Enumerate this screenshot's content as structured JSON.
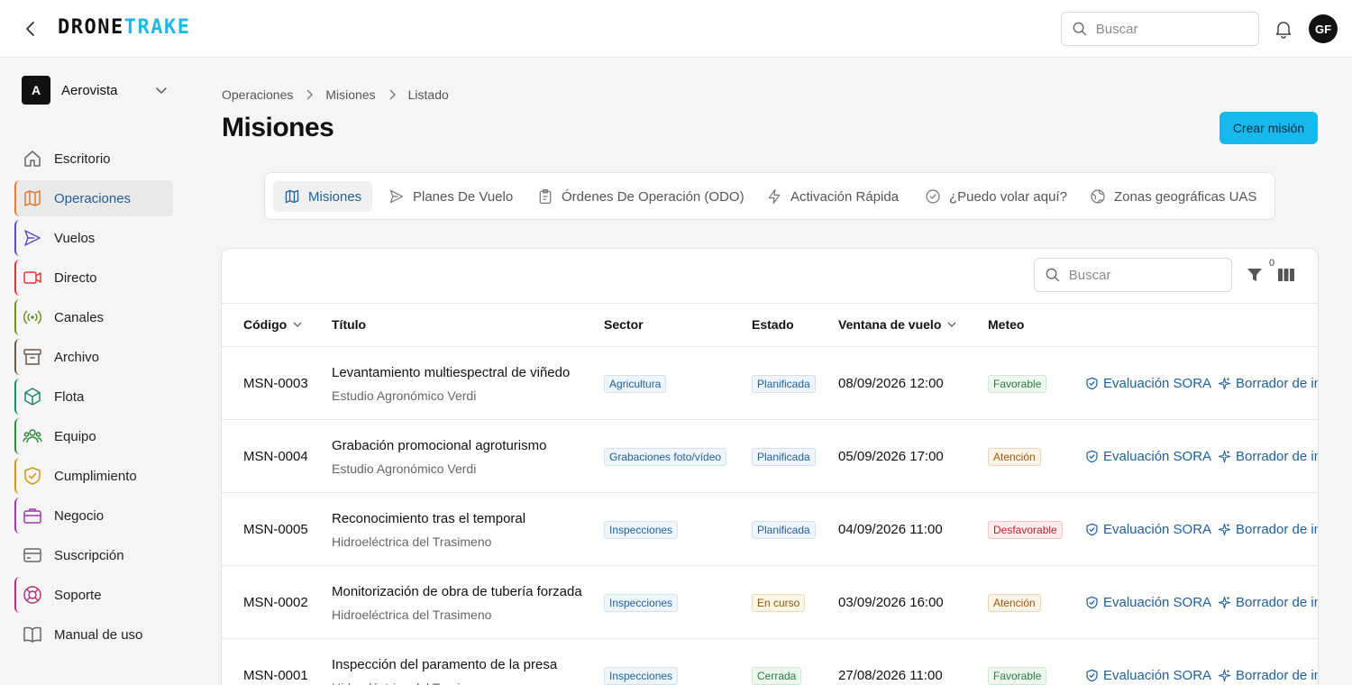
{
  "app": {
    "logo_part1": "DRONE",
    "logo_part2": "TRAKE",
    "accent": "#22b8e6"
  },
  "header": {
    "search_placeholder": "Buscar",
    "avatar_initials": "GF"
  },
  "sidebar": {
    "org_initial": "A",
    "org_name": "Aerovista",
    "items": [
      {
        "label": "Escritorio",
        "icon": "home-icon",
        "color": ""
      },
      {
        "label": "Operaciones",
        "icon": "map-icon",
        "color": "#e07b39",
        "active": true
      },
      {
        "label": "Vuelos",
        "icon": "send-icon",
        "color": "#5b4ccc"
      },
      {
        "label": "Directo",
        "icon": "video-icon",
        "color": "#d43b3b"
      },
      {
        "label": "Canales",
        "icon": "broadcast-icon",
        "color": "#6b8e23"
      },
      {
        "label": "Archivo",
        "icon": "archive-icon",
        "color": "#6b5a4a"
      },
      {
        "label": "Flota",
        "icon": "box-icon",
        "color": "#1f8a6a"
      },
      {
        "label": "Equipo",
        "icon": "users-icon",
        "color": "#2e8b3e"
      },
      {
        "label": "Cumplimiento",
        "icon": "shield-icon",
        "color": "#c89a12"
      },
      {
        "label": "Negocio",
        "icon": "briefcase-icon",
        "color": "#a03aa8"
      },
      {
        "label": "Suscripción",
        "icon": "credit-card-icon",
        "color": ""
      },
      {
        "label": "Soporte",
        "icon": "lifebuoy-icon",
        "color": "#b0357a"
      },
      {
        "label": "Manual de uso",
        "icon": "book-icon",
        "color": ""
      }
    ]
  },
  "breadcrumb": [
    "Operaciones",
    "Misiones",
    "Listado"
  ],
  "page": {
    "title": "Misiones",
    "create_button": "Crear misión"
  },
  "tabs": [
    {
      "label": "Misiones",
      "icon": "map-icon",
      "active": true
    },
    {
      "label": "Planes De Vuelo",
      "icon": "send-icon"
    },
    {
      "label": "Órdenes De Operación (ODO)",
      "icon": "clipboard-icon"
    },
    {
      "label": "Activación Rápida",
      "icon": "lightning-icon"
    },
    {
      "label": "¿Puedo volar aquí?",
      "icon": "check-circle-icon"
    },
    {
      "label": "Zonas geográficas UAS",
      "icon": "globe-icon"
    }
  ],
  "table": {
    "search_placeholder": "Buscar",
    "filter_count": "0",
    "columns": [
      "Código",
      "Título",
      "Sector",
      "Estado",
      "Ventana de vuelo",
      "Meteo"
    ],
    "action_sora": "Evaluación SORA",
    "action_draft": "Borrador de in",
    "rows": [
      {
        "code": "MSN-0003",
        "title": "Levantamiento multiespectral de viñedo",
        "client": "Estudio Agronómico Verdi",
        "sector": "Agricultura",
        "estado": "Planificada",
        "estado_kind": "plan",
        "window": "08/09/2026 12:00",
        "meteo": "Favorable",
        "meteo_kind": "fav"
      },
      {
        "code": "MSN-0004",
        "title": "Grabación promocional agroturismo",
        "client": "Estudio Agronómico Verdi",
        "sector": "Grabaciones foto/vídeo",
        "estado": "Planificada",
        "estado_kind": "plan",
        "window": "05/09/2026 17:00",
        "meteo": "Atención",
        "meteo_kind": "ate"
      },
      {
        "code": "MSN-0005",
        "title": "Reconocimiento tras el temporal",
        "client": "Hidroeléctrica del Trasimeno",
        "sector": "Inspecciones",
        "estado": "Planificada",
        "estado_kind": "plan",
        "window": "04/09/2026 11:00",
        "meteo": "Desfavorable",
        "meteo_kind": "des"
      },
      {
        "code": "MSN-0002",
        "title": "Monitorización de obra de tubería forzada",
        "client": "Hidroeléctrica del Trasimeno",
        "sector": "Inspecciones",
        "estado": "En curso",
        "estado_kind": "curso",
        "window": "03/09/2026 16:00",
        "meteo": "Atención",
        "meteo_kind": "ate"
      },
      {
        "code": "MSN-0001",
        "title": "Inspección del paramento de la presa",
        "client": "Hidroeléctrica del Trasimeno",
        "sector": "Inspecciones",
        "estado": "Cerrada",
        "estado_kind": "cerr",
        "window": "27/08/2026 11:00",
        "meteo": "Favorable",
        "meteo_kind": "fav"
      }
    ]
  }
}
